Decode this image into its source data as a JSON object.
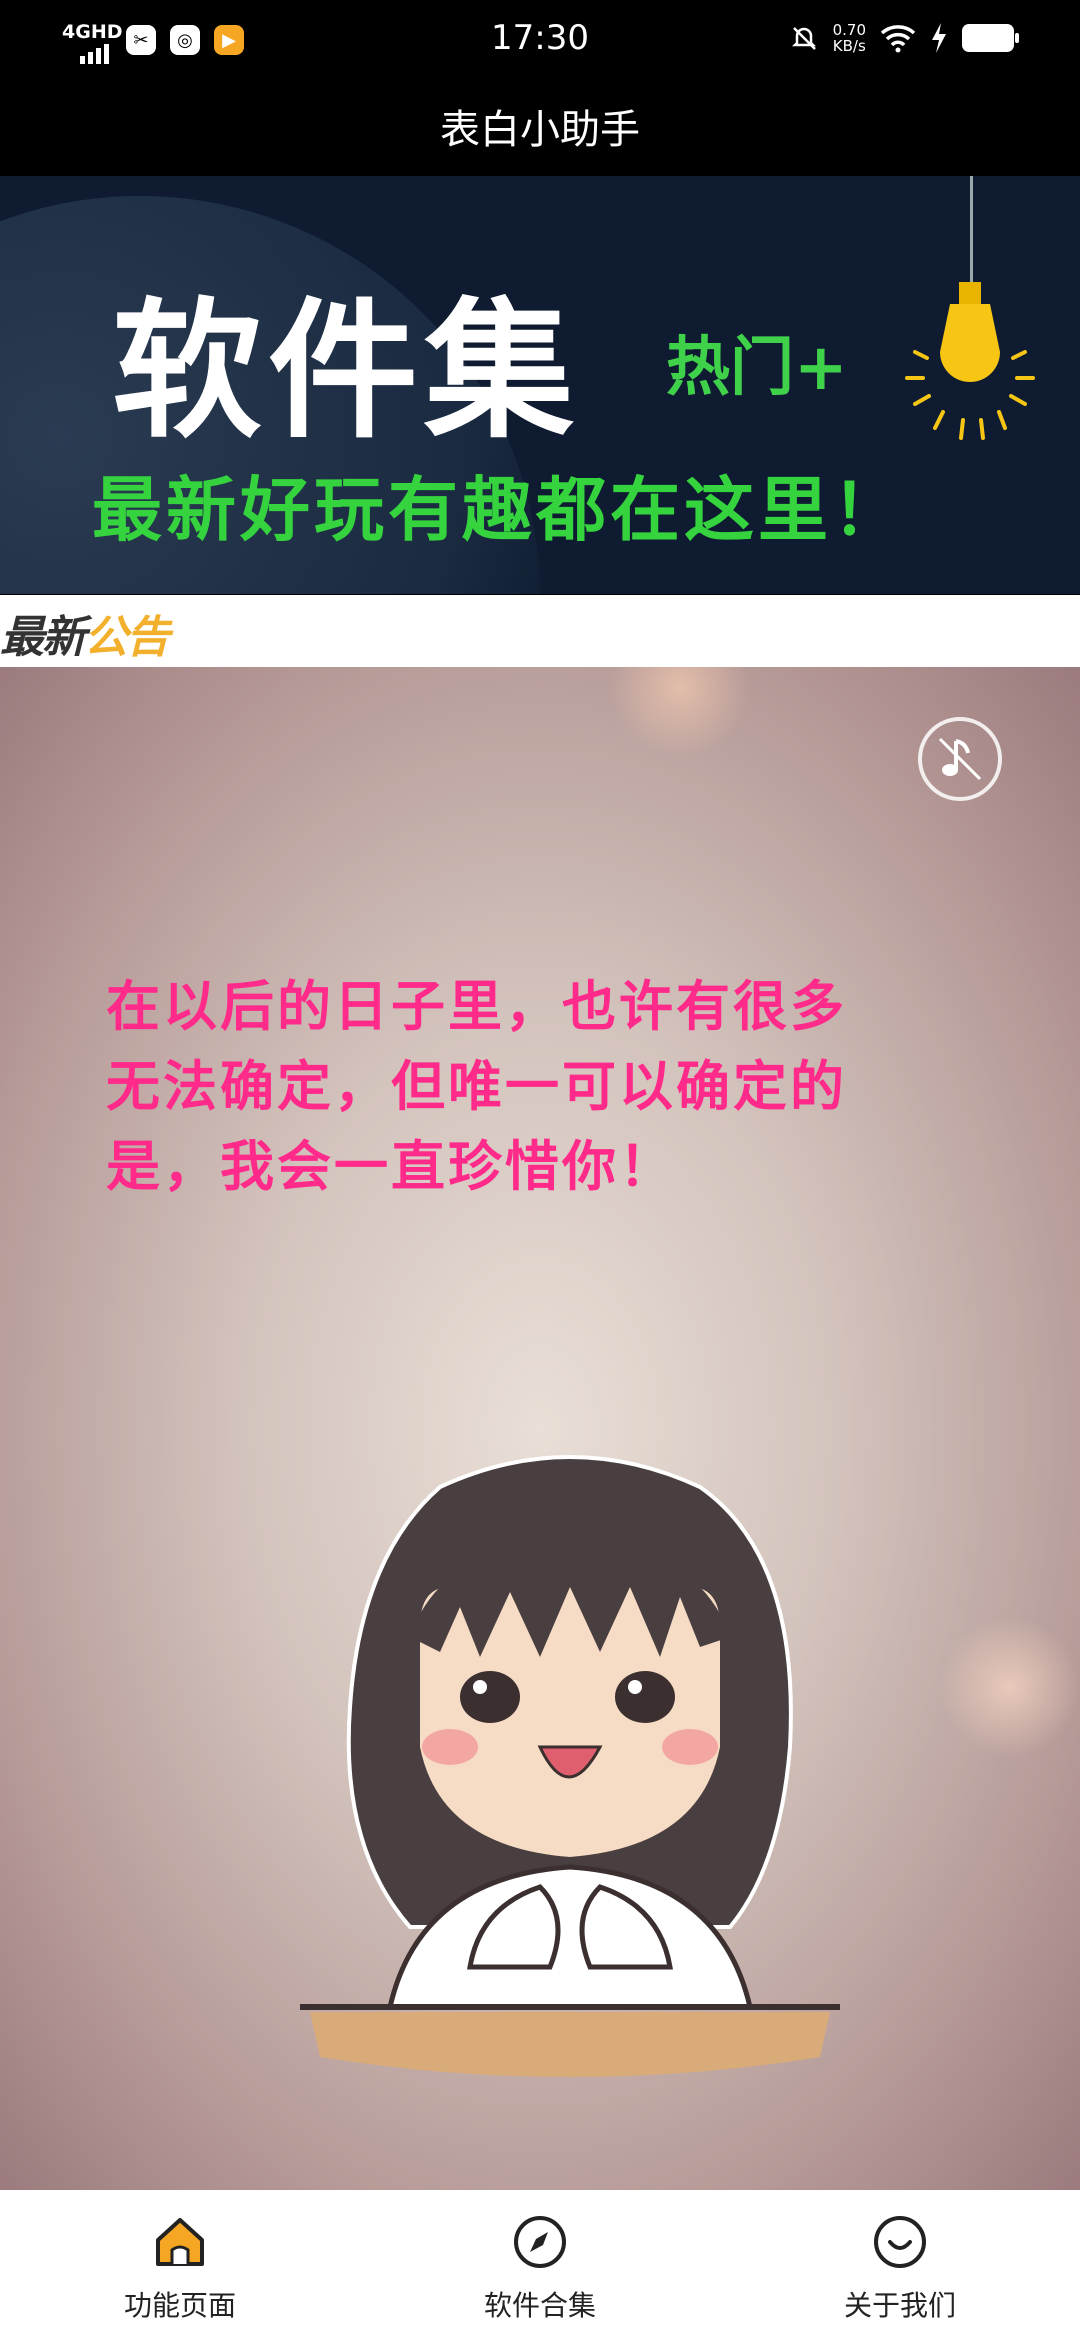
{
  "status_bar": {
    "network": "4GHD",
    "time": "17:30",
    "speed_value": "0.70",
    "speed_unit": "KB/s",
    "icons": [
      "signal-icon",
      "app-icon",
      "qq-icon",
      "video-app-icon",
      "mute-icon",
      "wifi-icon",
      "charging-icon",
      "battery-icon"
    ]
  },
  "header": {
    "title": "表白小助手"
  },
  "banner": {
    "title": "软件集",
    "hot": "热门+",
    "slogan": "最新好玩有趣都在这里！",
    "colors": {
      "background": "#0e1b31",
      "title": "#ffffff",
      "slogan": "#35d43e",
      "bulb": "#f7c614"
    }
  },
  "notice": {
    "label_part1": "最新",
    "label_part2": "公告"
  },
  "content": {
    "message_line1": "在以后的日子里，也许有很多",
    "message_line2": "无法确定，但唯一可以确定的",
    "message_line3": "是，我会一直珍惜你！",
    "text_color": "#ff2a8a",
    "music_icon": "music-off-icon"
  },
  "tabs": [
    {
      "label": "功能页面",
      "icon": "home-icon",
      "active": true
    },
    {
      "label": "软件合集",
      "icon": "compass-icon",
      "active": false
    },
    {
      "label": "关于我们",
      "icon": "smile-icon",
      "active": false
    }
  ]
}
